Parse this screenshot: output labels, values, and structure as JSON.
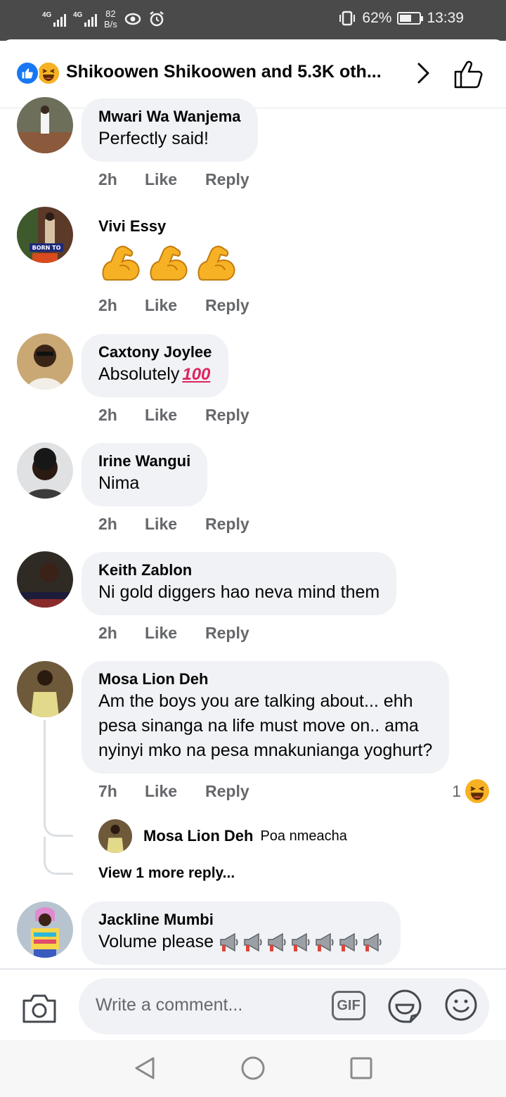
{
  "status_bar": {
    "network_1": "4G",
    "network_2": "4G",
    "speed": "82",
    "speed_unit": "B/s",
    "battery": "62%",
    "battery_level": 0.62,
    "time": "13:39"
  },
  "header": {
    "title": "Shikoowen Shikoowen and 5.3K oth...",
    "reaction_icons": [
      "like-icon",
      "haha-icon"
    ]
  },
  "comments": [
    {
      "name": "Mwari Wa Wanjema",
      "text": "Perfectly said!",
      "time": "2h",
      "like": "Like",
      "reply": "Reply"
    },
    {
      "name": "Vivi Essy",
      "text": "",
      "emoji": "flexed-biceps-icon",
      "emoji_count": 3,
      "time": "2h",
      "like": "Like",
      "reply": "Reply",
      "avatar_caption": "BORN TO"
    },
    {
      "name": "Caxtony Joylee",
      "text": "Absolutely",
      "emoji_text": "100",
      "time": "2h",
      "like": "Like",
      "reply": "Reply"
    },
    {
      "name": "Irine Wangui",
      "text": "Nima",
      "time": "2h",
      "like": "Like",
      "reply": "Reply"
    },
    {
      "name": "Keith Zablon",
      "text": "Ni gold diggers hao neva mind them",
      "time": "2h",
      "like": "Like",
      "reply": "Reply"
    },
    {
      "name": "Mosa Lion Deh",
      "lines": [
        "Am the boys you are talking about... ehh",
        "pesa sinanga na life must move on.. ama",
        "nyinyi mko na pesa mnakunianga yoghurt?"
      ],
      "time": "7h",
      "like": "Like",
      "reply": "Reply",
      "reaction_count": "1",
      "reply_preview": {
        "name": "Mosa Lion Deh",
        "text": "Poa nmeacha"
      },
      "view_more": "View 1 more reply..."
    },
    {
      "name": "Jackline Mumbi",
      "text": "Volume please",
      "emoji": "megaphone-icon",
      "emoji_count": 7
    }
  ],
  "composer": {
    "placeholder": "Write a comment...",
    "gif_label": "GIF"
  },
  "colors": {
    "accent": "#1877f2",
    "bubble": "#f0f2f5",
    "meta": "#65676b",
    "status_bar": "#4a4a4a"
  }
}
